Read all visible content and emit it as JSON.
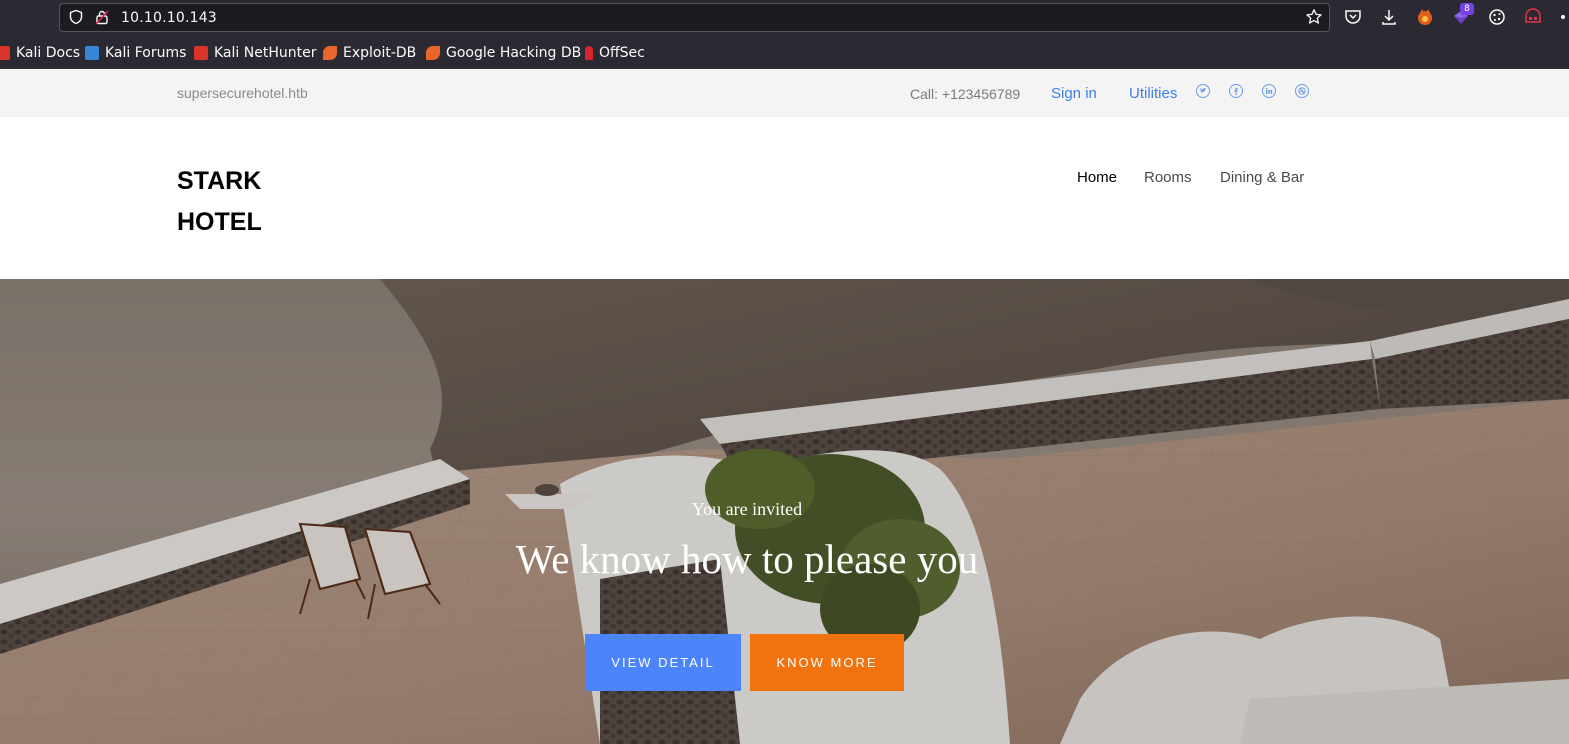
{
  "browser": {
    "url": "10.10.10.143",
    "extension_badge": "8",
    "bookmarks": [
      {
        "label": "Kali Docs",
        "icon": "kali-docs-icon",
        "color": "#d9342b"
      },
      {
        "label": "Kali Forums",
        "icon": "kali-forums-icon",
        "color": "#3a86d6"
      },
      {
        "label": "Kali NetHunter",
        "icon": "kali-nethunter-icon",
        "color": "#d9342b"
      },
      {
        "label": "Exploit-DB",
        "icon": "exploit-db-icon",
        "color": "#e8652b"
      },
      {
        "label": "Google Hacking DB",
        "icon": "google-hacking-db-icon",
        "color": "#e8652b"
      },
      {
        "label": "OffSec",
        "icon": "offsec-icon",
        "color": "#d9232d"
      }
    ]
  },
  "topbar": {
    "domain": "supersecurehotel.htb",
    "phone": "Call: +123456789",
    "signin": "Sign in",
    "utilities": "Utilities",
    "social": [
      "twitter-icon",
      "facebook-icon",
      "linkedin-icon",
      "dribbble-icon"
    ]
  },
  "header": {
    "logo_line1": "STARK",
    "logo_line2": "HOTEL",
    "nav": [
      "Home",
      "Rooms",
      "Dining & Bar"
    ]
  },
  "hero": {
    "tagline": "You are invited",
    "headline": "We know how to please you",
    "button_primary": "VIEW DETAIL",
    "button_secondary": "KNOW MORE"
  },
  "colors": {
    "accent_blue": "#4c84fb",
    "accent_orange": "#f0730f",
    "link_blue": "#3f7fe6"
  }
}
